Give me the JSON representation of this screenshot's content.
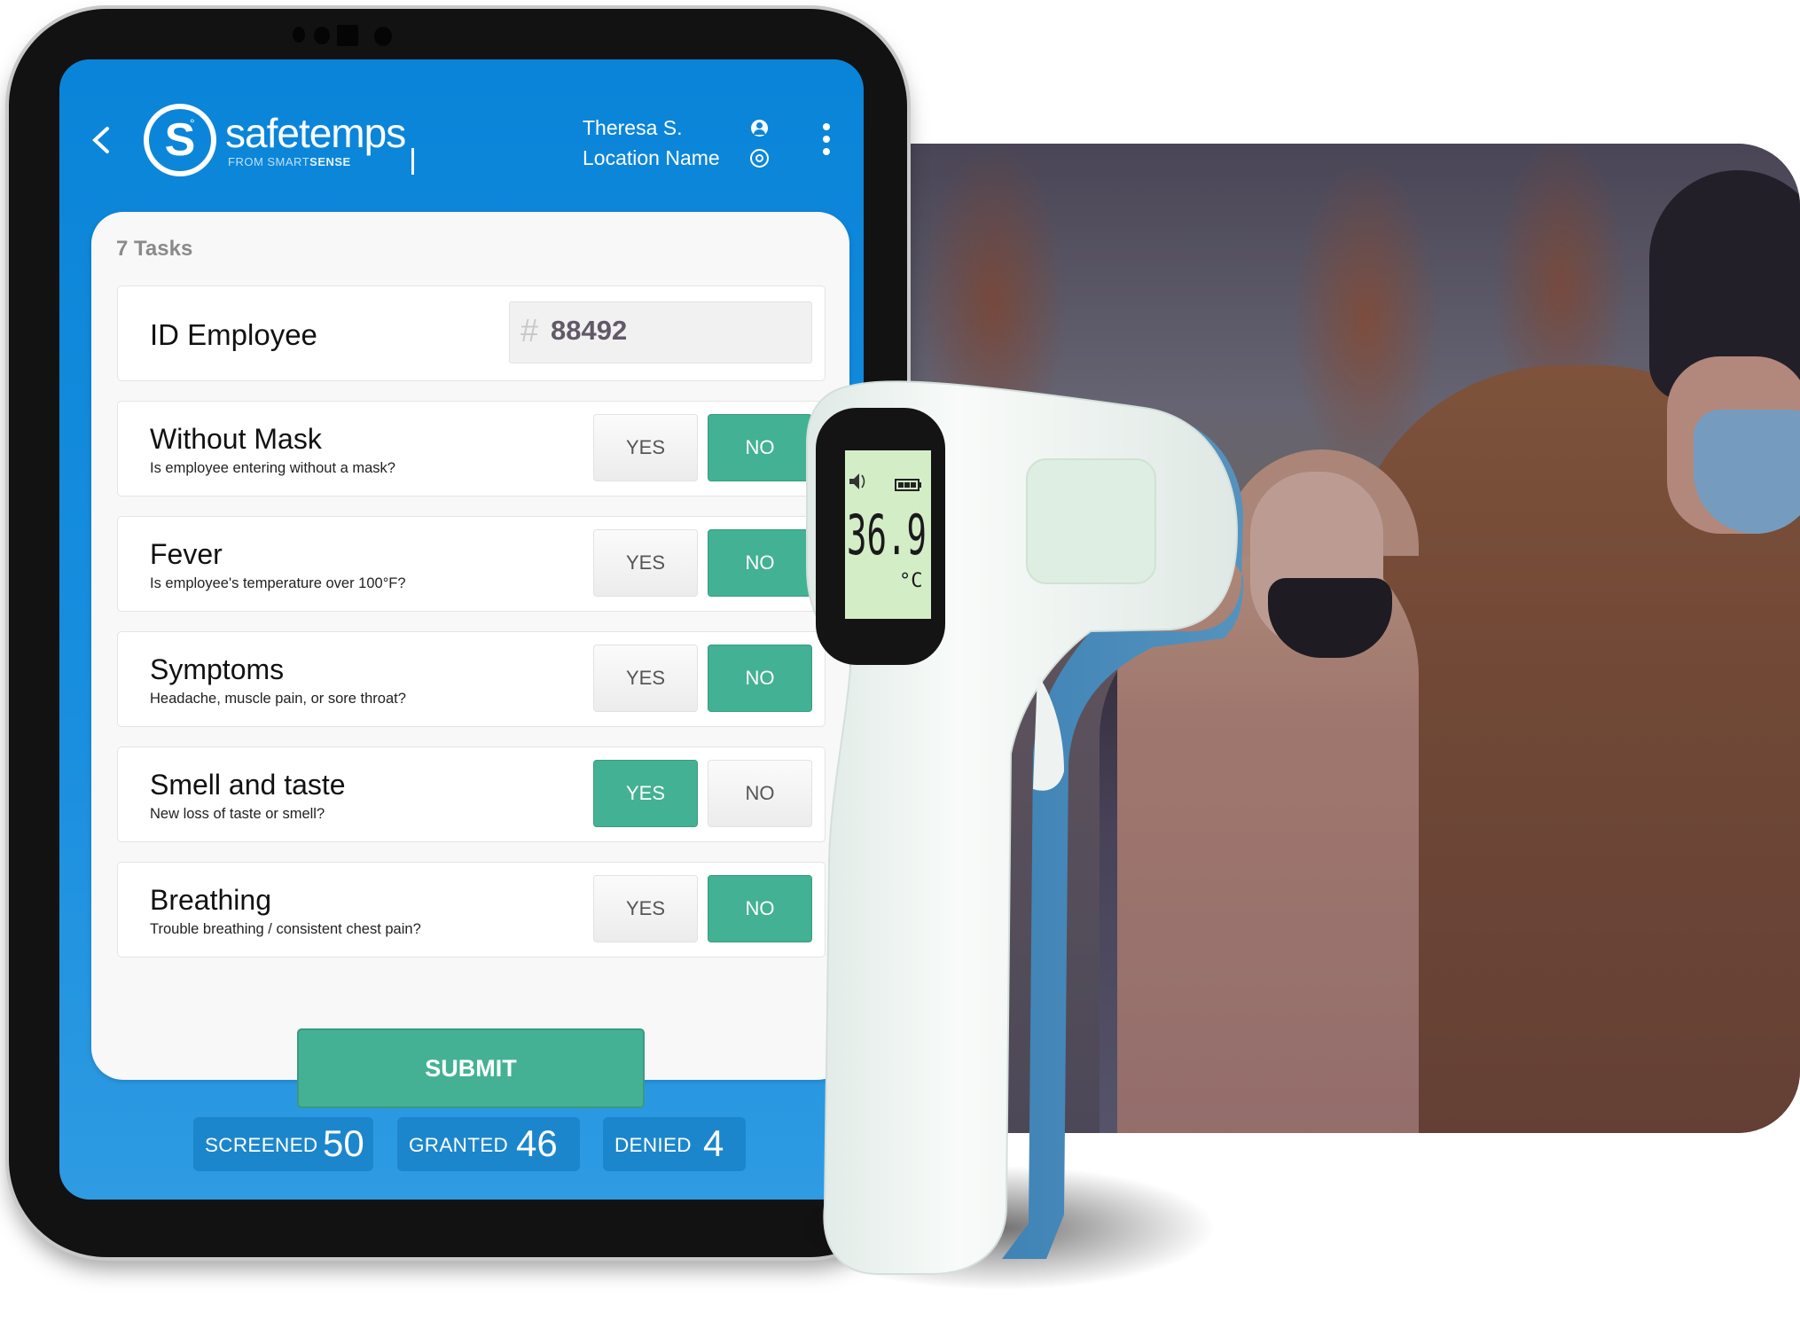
{
  "app": {
    "brand_name": "safetemps",
    "brand_sub_prefix": "FROM SMART",
    "brand_sub_bold": "SENSE",
    "logo_letter": "S",
    "logo_degree": "°"
  },
  "header": {
    "back_icon": "chevron-left-icon",
    "user_name": "Theresa S.",
    "user_icon": "user-circle-icon",
    "location_name": "Location Name",
    "location_icon": "target-icon",
    "menu_icon": "kebab-menu-icon"
  },
  "form": {
    "tasks_label": "7 Tasks",
    "id_field": {
      "label": "ID Employee",
      "prefix": "#",
      "value": "88492"
    },
    "questions": [
      {
        "title": "Without Mask",
        "subtitle": "Is employee entering without a mask?",
        "yes_label": "YES",
        "no_label": "NO",
        "selected": "NO"
      },
      {
        "title": "Fever",
        "subtitle": "Is employee's temperature over 100°F?",
        "yes_label": "YES",
        "no_label": "NO",
        "selected": "NO"
      },
      {
        "title": "Symptoms",
        "subtitle": "Headache, muscle pain, or sore throat?",
        "yes_label": "YES",
        "no_label": "NO",
        "selected": "NO"
      },
      {
        "title": "Smell and taste",
        "subtitle": "New loss of taste or smell?",
        "yes_label": "YES",
        "no_label": "NO",
        "selected": "YES"
      },
      {
        "title": "Breathing",
        "subtitle": "Trouble breathing / consistent chest pain?",
        "yes_label": "YES",
        "no_label": "NO",
        "selected": "NO"
      }
    ],
    "submit_label": "SUBMIT"
  },
  "stats": [
    {
      "label": "SCREENED",
      "value": "50"
    },
    {
      "label": "GRANTED",
      "value": "46"
    },
    {
      "label": "DENIED",
      "value": "4"
    }
  ],
  "thermometer": {
    "reading": "36.9",
    "unit": "°C",
    "speaker_icon": "speaker-icon",
    "battery_icon": "battery-icon"
  },
  "colors": {
    "primary_blue": "#0984d8",
    "accent_green": "#43b193",
    "stat_chip": "#1c86cc"
  }
}
